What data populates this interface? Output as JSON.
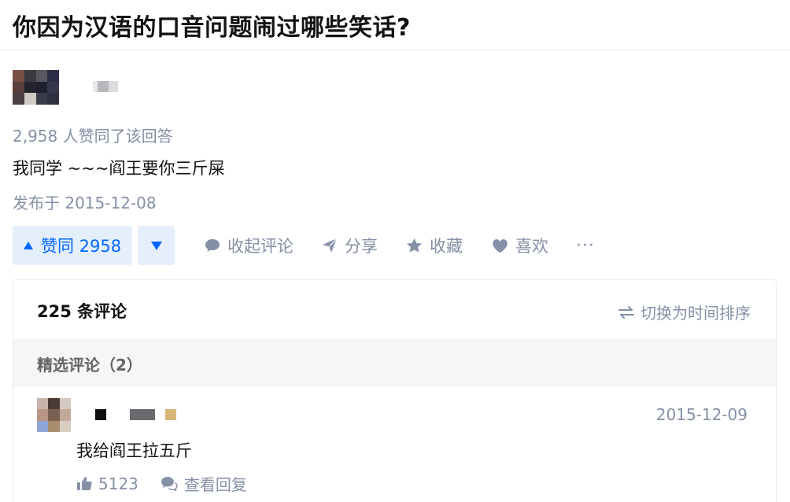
{
  "question": {
    "title": "你因为汉语的口音问题闹过哪些笑话?"
  },
  "answer": {
    "vote_summary": "2,958 人赞同了该回答",
    "content": "我同学 ~~~阎王要你三斤屎",
    "publish_time": "发布于 2015-12-08"
  },
  "actions": {
    "vote_up_label": "赞同 2958",
    "comment_label": "收起评论",
    "share_label": "分享",
    "favorite_label": "收藏",
    "like_label": "喜欢",
    "more_label": "···"
  },
  "comments": {
    "count_label": "225 条评论",
    "sort_label": "切换为时间排序",
    "featured_label": "精选评论（2）",
    "items": [
      {
        "time": "2015-12-09",
        "text": "我给阎王拉五斤",
        "likes": "5123",
        "reply_label": "查看回复"
      }
    ]
  },
  "colors": {
    "accent": "#0066ff",
    "vote_bg": "#e5effc",
    "meta": "#8590a6",
    "text": "#121212"
  }
}
